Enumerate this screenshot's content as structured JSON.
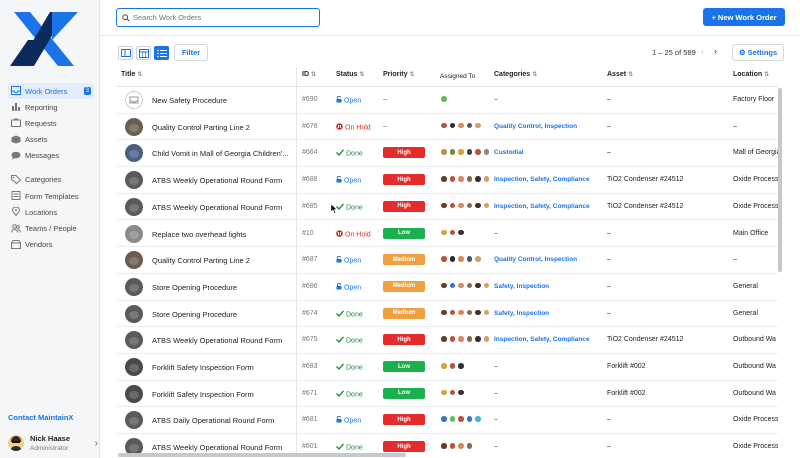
{
  "app": {
    "brand": "MaintainX"
  },
  "sidebar": {
    "items": [
      {
        "label": "Work Orders",
        "icon": "inbox-icon",
        "badge": "3",
        "active": true
      },
      {
        "label": "Reporting",
        "icon": "bar-chart-icon"
      },
      {
        "label": "Requests",
        "icon": "requests-icon"
      },
      {
        "label": "Assets",
        "icon": "assets-icon"
      },
      {
        "label": "Messages",
        "icon": "chat-icon"
      }
    ],
    "items2": [
      {
        "label": "Categories",
        "icon": "tag-icon"
      },
      {
        "label": "Form Templates",
        "icon": "form-icon"
      },
      {
        "label": "Locations",
        "icon": "location-pin-icon"
      },
      {
        "label": "Teams / People",
        "icon": "team-icon"
      },
      {
        "label": "Vendors",
        "icon": "vendor-icon"
      }
    ],
    "contact": "Contact MaintainX",
    "user": {
      "name": "Nick Haase",
      "role": "Administrator"
    }
  },
  "topbar": {
    "search_placeholder": "Search Work Orders",
    "new_button": "+ New Work Order"
  },
  "toolbar": {
    "filter": "Filter",
    "paging": "1 – 25 of 589",
    "settings": "Settings"
  },
  "table": {
    "headers": {
      "title": "Title",
      "id": "ID",
      "status": "Status",
      "priority": "Priority",
      "assigned": "Assigned To",
      "categories": "Categories",
      "asset": "Asset",
      "location": "Location"
    },
    "rows": [
      {
        "title": "New Safety Procedure",
        "id": "#690",
        "status": "Open",
        "priority": "–",
        "cat": "–",
        "asset": "–",
        "loc": "Factory Floor",
        "thumb": "empty",
        "avatars": [
          "#5bbf5a"
        ]
      },
      {
        "title": "Quality Control Parting Line 2",
        "id": "#676",
        "status": "On Hold",
        "priority": "–",
        "cat": "Quality Control, Inspection",
        "asset": "–",
        "loc": "–",
        "thumb": "#6b5d4f",
        "avatars": [
          "#b5543c",
          "#2b2b2b",
          "#d48a5c",
          "#555",
          "#c9a36a"
        ]
      },
      {
        "title": "Child Vomit in Mall of Georgia Children'...",
        "id": "#664",
        "status": "Done",
        "priority": "High",
        "cat": "Custodial",
        "asset": "–",
        "loc": "Mall of Georgia",
        "thumb": "#4a6080",
        "avatars": [
          "#c28a50",
          "#6b8f3a",
          "#d4a040",
          "#444",
          "#b5543c",
          "#888"
        ]
      },
      {
        "title": "ATBS Weekly Operational Round Form",
        "id": "#688",
        "status": "Open",
        "priority": "High",
        "cat": "Inspection, Safety, Compliance",
        "asset": "TiO2 Condenser #24512",
        "loc": "Oxide Process",
        "thumb": "#5a5a5a",
        "avatars": [
          "#6b3a2a",
          "#b5543c",
          "#d48a5c",
          "#8a6a4a",
          "#333",
          "#c9a36a"
        ]
      },
      {
        "title": "ATBS Weekly Operational Round Form",
        "id": "#685",
        "status": "Done",
        "priority": "High",
        "cat": "Inspection, Safety, Compliance",
        "asset": "TiO2 Condenser #24512",
        "loc": "Oxide Process",
        "thumb": "#5a5a5a",
        "avatars": [
          "#6b3a2a",
          "#b5543c",
          "#d48a5c",
          "#8a6a4a",
          "#333",
          "#c9a36a"
        ]
      },
      {
        "title": "Replace two overhead lights",
        "id": "#10",
        "status": "On Hold",
        "priority": "Low",
        "cat": "–",
        "asset": "–",
        "loc": "Main Office",
        "thumb": "#8a8a8a",
        "avatars": [
          "#d4a040",
          "#b5543c",
          "#333"
        ]
      },
      {
        "title": "Quality Control Parting Line 2",
        "id": "#687",
        "status": "Open",
        "priority": "Medium",
        "cat": "Quality Control, Inspection",
        "asset": "–",
        "loc": "–",
        "thumb": "#6b5d4f",
        "avatars": [
          "#b5543c",
          "#2b2b2b",
          "#d48a5c",
          "#555",
          "#c9a36a"
        ]
      },
      {
        "title": "Store Opening Procedure",
        "id": "#686",
        "status": "Open",
        "priority": "Medium",
        "cat": "Safety, Inspection",
        "asset": "–",
        "loc": "General",
        "thumb": "#5a5a5a",
        "avatars": [
          "#6b3a2a",
          "#3a6fd8",
          "#d48a5c",
          "#8a6a4a",
          "#333",
          "#c9a36a"
        ]
      },
      {
        "title": "Store Opening Procedure",
        "id": "#674",
        "status": "Done",
        "priority": "Medium",
        "cat": "Safety, Inspection",
        "asset": "–",
        "loc": "General",
        "thumb": "#5a5a5a",
        "avatars": [
          "#6b3a2a",
          "#b5543c",
          "#d48a5c",
          "#8a6a4a",
          "#333",
          "#c9a36a"
        ]
      },
      {
        "title": "ATBS Weekly Operational Round Form",
        "id": "#675",
        "status": "Done",
        "priority": "High",
        "cat": "Inspection, Safety, Compliance",
        "asset": "TiO2 Condenser #24512",
        "loc": "Outbound Wa",
        "thumb": "#5a5a5a",
        "avatars": [
          "#6b3a2a",
          "#b5543c",
          "#d48a5c",
          "#8a6a4a",
          "#333",
          "#c9a36a"
        ]
      },
      {
        "title": "Forklift Safety Inspection Form",
        "id": "#683",
        "status": "Done",
        "priority": "Low",
        "cat": "–",
        "asset": "Forklift #002",
        "loc": "Outbound Wa",
        "thumb": "#4a4a4a",
        "avatars": [
          "#d4a040",
          "#b5543c",
          "#333"
        ]
      },
      {
        "title": "Forklift Safety Inspection Form",
        "id": "#671",
        "status": "Done",
        "priority": "Low",
        "cat": "–",
        "asset": "Forklift #002",
        "loc": "Outbound Wa",
        "thumb": "#4a4a4a",
        "avatars": [
          "#d4a040",
          "#b5543c",
          "#333"
        ]
      },
      {
        "title": "ATBS Daily Operational Round Form",
        "id": "#681",
        "status": "Open",
        "priority": "High",
        "cat": "–",
        "asset": "–",
        "loc": "Oxide Process",
        "thumb": "#5a5a5a",
        "avatars": [
          "#3a6fd8",
          "#5bbf5a",
          "#b5543c",
          "#3a6fd8",
          "#4ab0d8"
        ]
      },
      {
        "title": "ATBS Weekly Operational Round Form",
        "id": "#601",
        "status": "Done",
        "priority": "High",
        "cat": "–",
        "asset": "–",
        "loc": "Oxide Process",
        "thumb": "#5a5a5a",
        "avatars": [
          "#6b3a2a",
          "#b5543c",
          "#d48a5c",
          "#8a6a4a"
        ]
      }
    ]
  }
}
